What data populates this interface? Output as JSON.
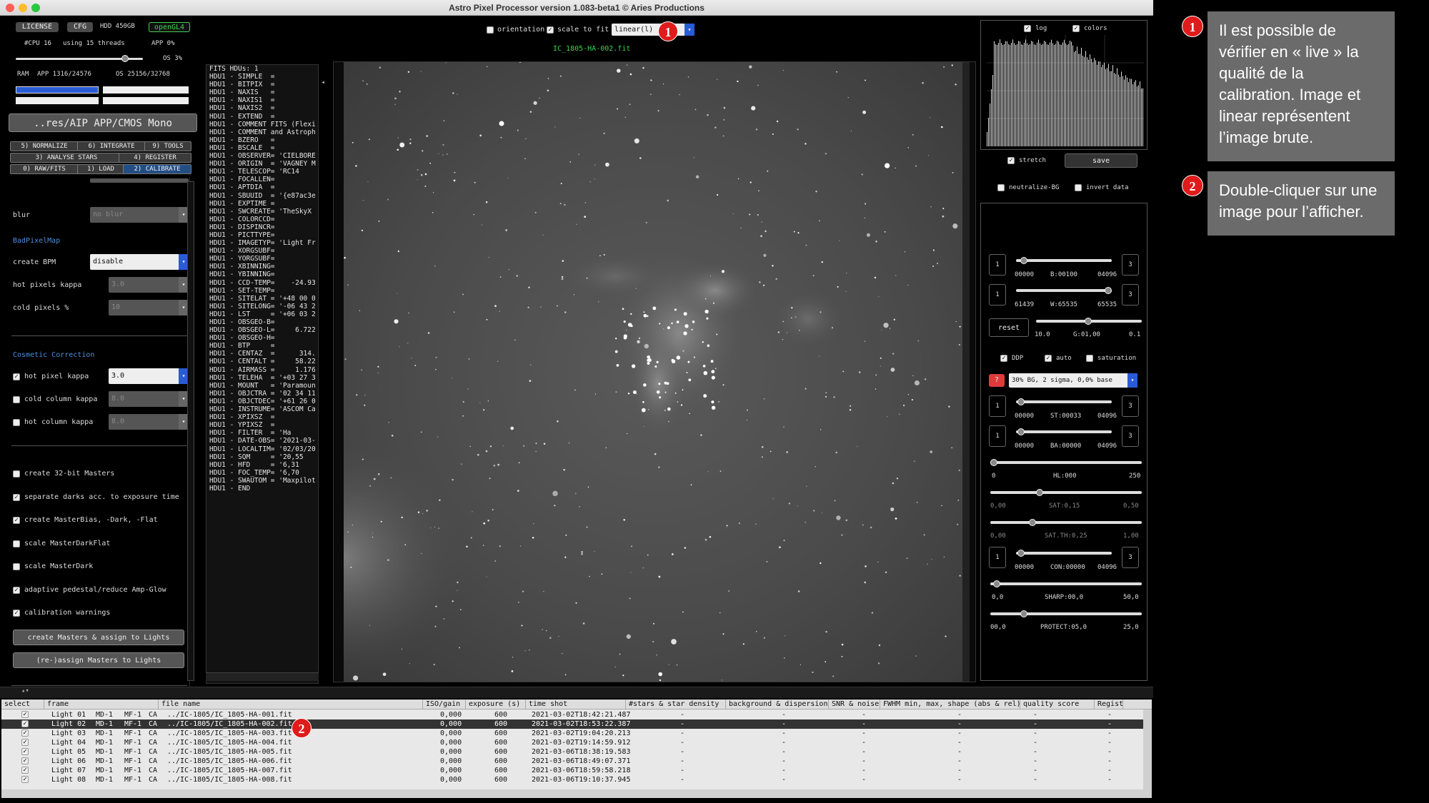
{
  "window": {
    "title": "Astro Pixel Processor version 1.083-beta1 © Aries Productions"
  },
  "status": {
    "license": "LICENSE",
    "cfg": "CFG",
    "hdd": "HDD 450GB",
    "opengl": "openGL4",
    "cpu": "#CPU 16",
    "threads": "using 15 threads",
    "app_cpu": "APP 0%",
    "os_cpu": "OS 3%",
    "ram": "RAM",
    "ram_app": "APP 1316/24576",
    "ram_os": "OS 25156/32768"
  },
  "project_path": "..res/AIP APP/CMOS Mono",
  "tabs": [
    "5) NORMALIZE",
    "6) INTEGRATE",
    "9) TOOLS",
    "3) ANALYSE STARS",
    "4) REGISTER",
    "0) RAW/FITS",
    "1) LOAD",
    "2) CALIBRATE"
  ],
  "calibrate": {
    "blur_label": "blur",
    "blur_value": "no blur",
    "bpm_header": "BadPixelMap",
    "create_bpm_label": "create BPM",
    "create_bpm_value": "disable",
    "hot_kappa_label": "hot pixels kappa",
    "hot_kappa_value": "3.0",
    "cold_pct_label": "cold pixels %",
    "cold_pct_value": "10",
    "cosmetic_header": "Cosmetic Correction",
    "hot_pixel_kappa_label": "hot pixel kappa",
    "hot_pixel_kappa_value": "3.0",
    "cold_column_label": "cold column kappa",
    "cold_column_value": "8.0",
    "hot_column_label": "hot column kappa",
    "hot_column_value": "8.0",
    "options": [
      {
        "label": "create 32-bit Masters",
        "checked": false
      },
      {
        "label": "separate darks acc. to exposure time",
        "checked": true
      },
      {
        "label": "create MasterBias, -Dark, -Flat",
        "checked": true
      },
      {
        "label": "scale MasterDarkFlat",
        "checked": false
      },
      {
        "label": "scale MasterDark",
        "checked": false
      },
      {
        "label": "adaptive pedestal/reduce Amp-Glow",
        "checked": true
      },
      {
        "label": "calibration warnings",
        "checked": true
      }
    ],
    "create_masters_btn": "create Masters & assign to Lights",
    "reassign_btn": "(re-)assign Masters to Lights"
  },
  "toolbar": {
    "orientation": "orientation",
    "scale_to_fit": "scale to fit",
    "stretch_mode": "linear(l)",
    "filename": "IC_1805-HA-002.fit"
  },
  "fits_header": [
    "FITS HDUs: 1",
    "HDU1 - SIMPLE  =",
    "HDU1 - BITPIX  =",
    "HDU1 - NAXIS   =",
    "HDU1 - NAXIS1  =",
    "HDU1 - NAXIS2  =",
    "HDU1 - EXTEND  =",
    "HDU1 - COMMENT FITS (Flexi",
    "HDU1 - COMMENT and Astroph",
    "HDU1 - BZERO   =",
    "HDU1 - BSCALE  =",
    "HDU1 - OBSERVER= 'CIELBORE",
    "HDU1 - ORIGIN  = 'VAGNEY M",
    "HDU1 - TELESCOP= 'RC14",
    "HDU1 - FOCALLEN=",
    "HDU1 - APTDIA  =",
    "HDU1 - SBUUID  = '{e87ac3e",
    "HDU1 - EXPTIME =",
    "HDU1 - SWCREATE= 'TheSkyX",
    "HDU1 - COLORCCD=",
    "HDU1 - DISPINCR=",
    "HDU1 - PICTTYPE=",
    "HDU1 - IMAGETYP= 'Light Fr",
    "HDU1 - XORGSUBF=",
    "HDU1 - YORGSUBF=",
    "HDU1 - XBINNING=",
    "HDU1 - YBINNING=",
    "HDU1 - CCD-TEMP=    -24.93",
    "HDU1 - SET-TEMP=",
    "HDU1 - SITELAT = '+48 00 0",
    "HDU1 - SITELONG= '-06 43 2",
    "HDU1 - LST     = '+06 03 2",
    "HDU1 - OBSGEO-B=",
    "HDU1 - OBSGEO-L=     6.722",
    "HDU1 - OBSGEO-H=",
    "HDU1 - BTP     =",
    "HDU1 - CENTAZ  =      314.",
    "HDU1 - CENTALT =     58.22",
    "HDU1 - AIRMASS =     1.176",
    "HDU1 - TELEHA  = '+03 27 3",
    "HDU1 - MOUNT   = 'Paramoun",
    "HDU1 - OBJCTRA = '02 34 11",
    "HDU1 - OBJCTDEC= '+61 26 0",
    "HDU1 - INSTRUME= 'ASCOM Ca",
    "HDU1 - XPIXSZ  =",
    "HDU1 - YPIXSZ  =",
    "HDU1 - FILTER  = 'Ha",
    "HDU1 - DATE-OBS= '2021-03-",
    "HDU1 - LOCALTIM= '02/03/20",
    "HDU1 - SQM     = '20,55",
    "HDU1 - HFD     = '6,31",
    "HDU1 - FOC_TEMP= '6,70",
    "HDU1 - SWAUTOM = 'Maxpilot",
    "HDU1 - END"
  ],
  "right_panel": {
    "log": "log",
    "colors": "colors",
    "stretch": "stretch",
    "save": "save",
    "neutralize": "neutralize-BG",
    "invert": "invert data",
    "b_min": "00000",
    "b_label": "B:00100",
    "b_max": "04096",
    "w_min": "61439",
    "w_label": "W:65535",
    "w_max": "65535",
    "reset": "reset",
    "g_min": "10.0",
    "g_label": "G:01,00",
    "g_max": "0.1",
    "ddp": "DDP",
    "auto": "auto",
    "saturation": "saturation",
    "q": "?",
    "preset": "30% BG, 2 sigma, 0,0% base",
    "st_min": "00000",
    "st_label": "ST:00033",
    "st_max": "04096",
    "ba_min": "00000",
    "ba_label": "BA:00000",
    "ba_max": "04096",
    "hl_min": "0",
    "hl_label": "HL:000",
    "hl_max": "250",
    "sat_min": "0,00",
    "sat_label": "SAT:0,15",
    "sat_max": "0,50",
    "satth_min": "0,00",
    "satth_label": "SAT.TH:0,25",
    "satth_max": "1,00",
    "con_min": "00000",
    "con_label": "CON:00000",
    "con_max": "04096",
    "sharp_min": "0,0",
    "sharp_label": "SHARP:00,0",
    "sharp_max": "50,0",
    "protect_min": "00,0",
    "protect_label": "PROTECT:05,0",
    "protect_max": "25,0",
    "one": "1",
    "three": "3"
  },
  "table": {
    "headers": [
      "select",
      "frame",
      "file name",
      "ISO/gain",
      "exposure (s)",
      "time shot",
      "#stars & star density",
      "background & dispersion",
      "SNR & noise",
      "FWHM min, max, shape (abs & rel)",
      "quality score",
      "Registra"
    ],
    "rows": [
      {
        "frame": "Light 01",
        "md": "MD-1",
        "mf": "MF-1",
        "ca": "CA",
        "file": "../IC-1805/IC_1805-HA-001.fit",
        "iso": "0,000",
        "exp": "600",
        "time": "2021-03-02T18:42:21.487"
      },
      {
        "frame": "Light 02",
        "md": "MD-1",
        "mf": "MF-1",
        "ca": "CA",
        "file": "../IC-1805/IC_1805-HA-002.fit",
        "iso": "0,000",
        "exp": "600",
        "time": "2021-03-02T18:53:22.387"
      },
      {
        "frame": "Light 03",
        "md": "MD-1",
        "mf": "MF-1",
        "ca": "CA",
        "file": "../IC-1805/IC_1805-HA-003.fit",
        "iso": "0,000",
        "exp": "600",
        "time": "2021-03-02T19:04:20.213"
      },
      {
        "frame": "Light 04",
        "md": "MD-1",
        "mf": "MF-1",
        "ca": "CA",
        "file": "../IC-1805/IC_1805-HA-004.fit",
        "iso": "0,000",
        "exp": "600",
        "time": "2021-03-02T19:14:59.912"
      },
      {
        "frame": "Light 05",
        "md": "MD-1",
        "mf": "MF-1",
        "ca": "CA",
        "file": "../IC-1805/IC_1805-HA-005.fit",
        "iso": "0,000",
        "exp": "600",
        "time": "2021-03-06T18:38:19.583"
      },
      {
        "frame": "Light 06",
        "md": "MD-1",
        "mf": "MF-1",
        "ca": "CA",
        "file": "../IC-1805/IC_1805-HA-006.fit",
        "iso": "0,000",
        "exp": "600",
        "time": "2021-03-06T18:49:07.371"
      },
      {
        "frame": "Light 07",
        "md": "MD-1",
        "mf": "MF-1",
        "ca": "CA",
        "file": "../IC-1805/IC_1805-HA-007.fit",
        "iso": "0,000",
        "exp": "600",
        "time": "2021-03-06T18:59:58.218"
      },
      {
        "frame": "Light 08",
        "md": "MD-1",
        "mf": "MF-1",
        "ca": "CA",
        "file": "../IC-1805/IC_1805-HA-008.fit",
        "iso": "0,000",
        "exp": "600",
        "time": "2021-03-06T19:10:37.945"
      }
    ],
    "dash": "-",
    "selected_row": 1
  },
  "callouts": [
    {
      "num": "1",
      "text": "Il est possible de vérifier en « live » la qualité de la calibration. Image et linear représentent l’image brute."
    },
    {
      "num": "2",
      "text": "Double-cliquer sur une image pour l’afficher."
    }
  ],
  "colors": {
    "accent_red": "#e01b1b",
    "tab_active": "#234e84",
    "status_green": "#3fd44f",
    "selected_row": "#333333"
  }
}
